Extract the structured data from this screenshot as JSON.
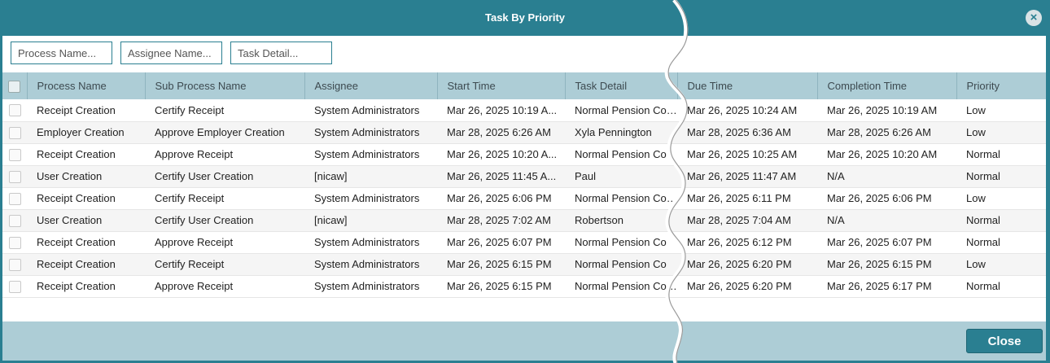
{
  "window": {
    "title": "Task By Priority",
    "close_icon": "×"
  },
  "filters": [
    {
      "placeholder": "Process Name..."
    },
    {
      "placeholder": "Assignee Name..."
    },
    {
      "placeholder": "Task Detail..."
    }
  ],
  "columns": [
    "Process Name",
    "Sub Process Name",
    "Assignee",
    "Start Time",
    "Task Detail",
    "Due Time",
    "Completion Time",
    "Priority"
  ],
  "rows": [
    [
      "Receipt Creation",
      "Certify Receipt",
      "System Administrators",
      "Mar 26, 2025 10:19 A...",
      "Normal Pension Contri",
      "Mar 26, 2025 10:24 AM",
      "Mar 26, 2025 10:19 AM",
      "Low"
    ],
    [
      "Employer Creation",
      "Approve Employer Creation",
      "System Administrators",
      "Mar 28, 2025 6:26 AM",
      "Xyla Pennington",
      "Mar 28, 2025 6:36 AM",
      "Mar 28, 2025 6:26 AM",
      "Low"
    ],
    [
      "Receipt Creation",
      "Approve Receipt",
      "System Administrators",
      "Mar 26, 2025 10:20 A...",
      "Normal Pension Co",
      "Mar 26, 2025 10:25 AM",
      "Mar 26, 2025 10:20 AM",
      "Normal"
    ],
    [
      "User Creation",
      "Certify User Creation",
      "[nicaw]",
      "Mar 26, 2025 11:45 A...",
      "Paul",
      "Mar 26, 2025 11:47 AM",
      "N/A",
      "Normal"
    ],
    [
      "Receipt Creation",
      "Certify Receipt",
      "System Administrators",
      "Mar 26, 2025 6:06 PM",
      "Normal Pension Contri",
      "Mar 26, 2025 6:11 PM",
      "Mar 26, 2025 6:06 PM",
      "Low"
    ],
    [
      "User Creation",
      "Certify User Creation",
      "[nicaw]",
      "Mar 28, 2025 7:02 AM",
      "Robertson",
      "Mar 28, 2025 7:04 AM",
      "N/A",
      "Normal"
    ],
    [
      "Receipt Creation",
      "Approve Receipt",
      "System Administrators",
      "Mar 26, 2025 6:07 PM",
      "Normal Pension Co",
      "Mar 26, 2025 6:12 PM",
      "Mar 26, 2025 6:07 PM",
      "Normal"
    ],
    [
      "Receipt Creation",
      "Certify Receipt",
      "System Administrators",
      "Mar 26, 2025 6:15 PM",
      "Normal Pension Co",
      "Mar 26, 2025 6:20 PM",
      "Mar 26, 2025 6:15 PM",
      "Low"
    ],
    [
      "Receipt Creation",
      "Approve Receipt",
      "System Administrators",
      "Mar 26, 2025 6:15 PM",
      "Normal Pension Contri",
      "Mar 26, 2025 6:20 PM",
      "Mar 26, 2025 6:17 PM",
      "Normal"
    ]
  ],
  "footer": {
    "close_label": "Close"
  },
  "colors": {
    "primary": "#2a7f91",
    "header_bg": "#adcdd6",
    "row_alt": "#f5f5f5"
  }
}
